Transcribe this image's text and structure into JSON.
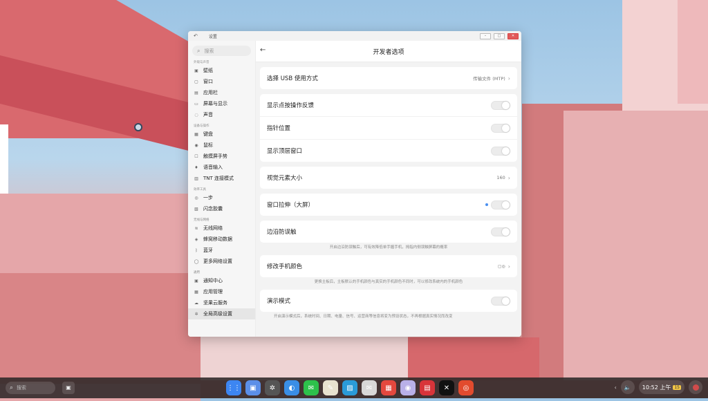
{
  "window": {
    "title": "设置",
    "back_glyph": "↶",
    "controls": [
      "–",
      "□",
      "✕"
    ]
  },
  "sidebar": {
    "search_placeholder": "搜索",
    "groups": [
      {
        "title": "外观与声音",
        "items": [
          {
            "label": "壁纸",
            "icon": "image-icon",
            "glyph": "▣"
          },
          {
            "label": "窗口",
            "icon": "window-icon",
            "glyph": "▢"
          },
          {
            "label": "应用栏",
            "icon": "taskbar-icon",
            "glyph": "▤"
          },
          {
            "label": "屏幕与显示",
            "icon": "display-icon",
            "glyph": "▭"
          },
          {
            "label": "声音",
            "icon": "sound-icon",
            "glyph": "◌"
          }
        ]
      },
      {
        "title": "设备与操作",
        "items": [
          {
            "label": "键盘",
            "icon": "keyboard-icon",
            "glyph": "▦"
          },
          {
            "label": "鼠标",
            "icon": "mouse-icon",
            "glyph": "◉"
          },
          {
            "label": "触摸屏手势",
            "icon": "touch-gesture-icon",
            "glyph": "☐"
          },
          {
            "label": "语音输入",
            "icon": "microphone-icon",
            "glyph": "♦"
          },
          {
            "label": "TNT 连接模式",
            "icon": "tnt-connect-icon",
            "glyph": "▥"
          }
        ]
      },
      {
        "title": "效率工具",
        "items": [
          {
            "label": "一步",
            "icon": "one-step-icon",
            "glyph": "◎"
          },
          {
            "label": "闪念胶囊",
            "icon": "capsule-icon",
            "glyph": "▧"
          }
        ]
      },
      {
        "title": "无线与网络",
        "items": [
          {
            "label": "无线网络",
            "icon": "wifi-icon",
            "glyph": "≋"
          },
          {
            "label": "蜂窝移动数据",
            "icon": "cellular-icon",
            "glyph": "◈"
          },
          {
            "label": "蓝牙",
            "icon": "bluetooth-icon",
            "glyph": "ᛒ"
          },
          {
            "label": "更多网络设置",
            "icon": "more-network-icon",
            "glyph": "◯"
          }
        ]
      },
      {
        "title": "通用",
        "items": [
          {
            "label": "通知中心",
            "icon": "notification-icon",
            "glyph": "▣"
          },
          {
            "label": "应用管理",
            "icon": "app-manage-icon",
            "glyph": "▦"
          },
          {
            "label": "坚果云服务",
            "icon": "cloud-icon",
            "glyph": "☁"
          },
          {
            "label": "全局高级设置",
            "icon": "advanced-settings-icon",
            "glyph": "✲"
          }
        ]
      }
    ],
    "active_item": "全局高级设置"
  },
  "main": {
    "title": "开发者选项",
    "back_glyph": "←",
    "usb": {
      "label": "选择 USB 使用方式",
      "value": "传输文件 (MTP)"
    },
    "show_touches": {
      "label": "显示点按操作反馈",
      "on": false
    },
    "pointer_location": {
      "label": "指针位置",
      "on": false
    },
    "show_top_window": {
      "label": "显示顶层窗口",
      "on": false
    },
    "visual_size": {
      "label": "视觉元素大小",
      "value": "160"
    },
    "window_stretch": {
      "label": "窗口拉伸（大屏）",
      "on": false
    },
    "edge_guard": {
      "label": "边沿防误触",
      "on": false,
      "hint": "开启边沿防误触后，可有效降低单手握手机，拇指内侧误触屏幕的概率"
    },
    "phone_color": {
      "label": "修改手机颜色",
      "hint": "更换主板后，主板默认的手机颜色与真实的手机颜色不同时，可以修改系统内的手机颜色"
    },
    "demo_mode": {
      "label": "演示模式",
      "on": false,
      "hint": "开启演示模式后，系统时间、日期、电量、信号、运营商等信息将变为预设状态，不再根据真实情况而改变"
    }
  },
  "taskbar": {
    "search_placeholder": "搜索",
    "apps": [
      {
        "name": "launcher-icon",
        "glyph": "⋮⋮",
        "color": "#3d86f2"
      },
      {
        "name": "file-manager-icon",
        "glyph": "▣",
        "color": "#5b8fe8"
      },
      {
        "name": "settings-icon",
        "glyph": "✲",
        "color": "#555555"
      },
      {
        "name": "browser-icon",
        "glyph": "◐",
        "color": "#3a8ee6"
      },
      {
        "name": "wechat-icon",
        "glyph": "✉",
        "color": "#2dc14b"
      },
      {
        "name": "notes-icon",
        "glyph": "✎",
        "color": "#e8e2cf"
      },
      {
        "name": "gallery-icon",
        "glyph": "▨",
        "color": "#2a9bd8"
      },
      {
        "name": "messages-icon",
        "glyph": "✉",
        "color": "#d8d8d8"
      },
      {
        "name": "calendar-icon",
        "glyph": "▦",
        "color": "#e4483e"
      },
      {
        "name": "music-icon",
        "glyph": "◉",
        "color": "#b9b0e8"
      },
      {
        "name": "news-icon",
        "glyph": "▤",
        "color": "#d8343a"
      },
      {
        "name": "capcut-icon",
        "glyph": "✕",
        "color": "#111111"
      },
      {
        "name": "weibo-icon",
        "glyph": "◎",
        "color": "#e24b2e"
      }
    ],
    "time": "10:52 上午",
    "calendar_badge": "15",
    "collapse_arrow": "‹",
    "volume_glyph": "🔈"
  }
}
